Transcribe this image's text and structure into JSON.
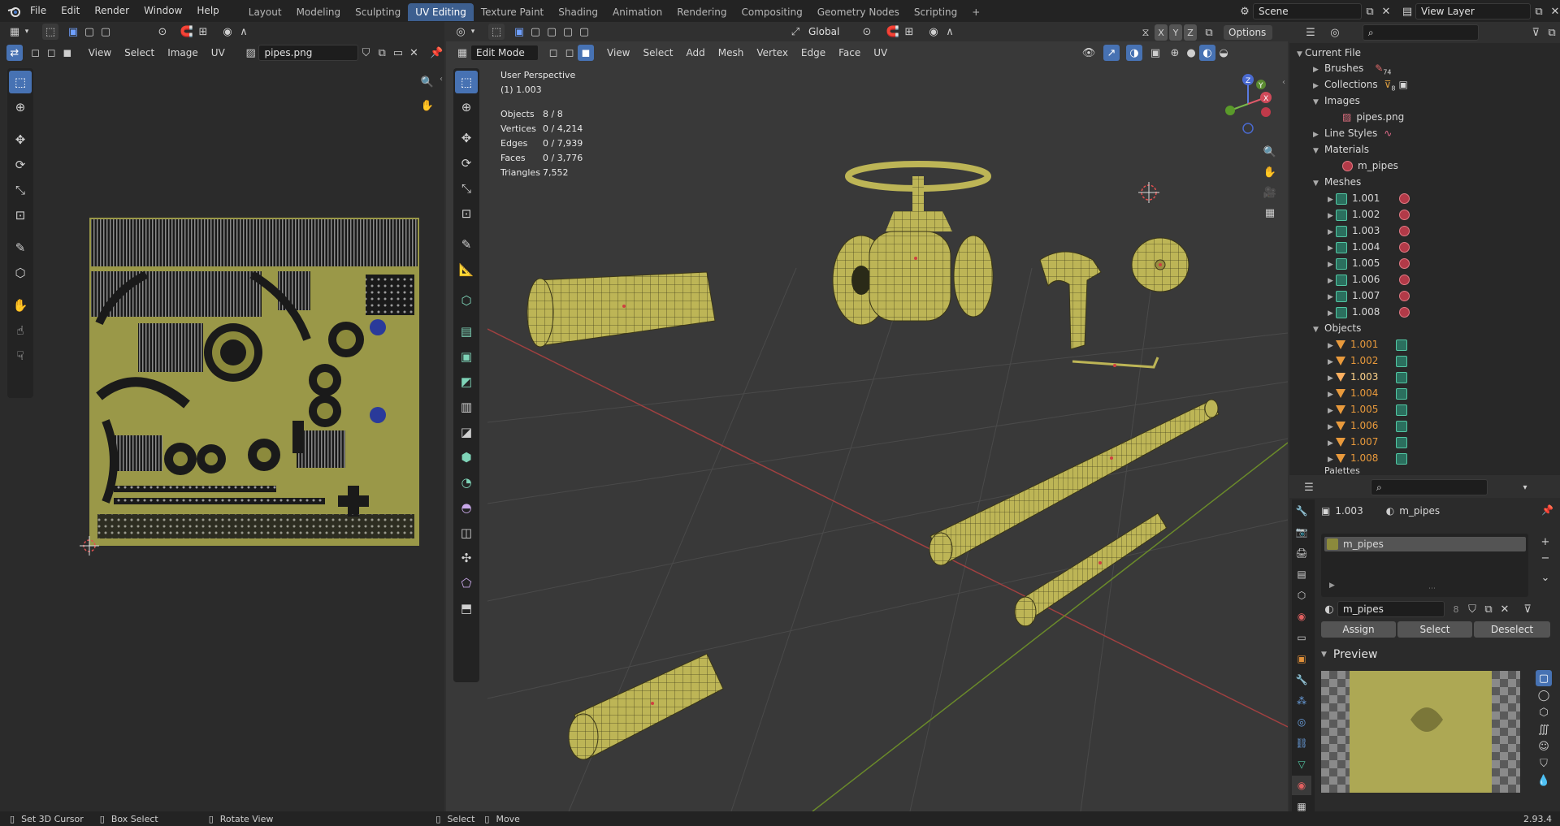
{
  "top_menu": {
    "items": [
      "File",
      "Edit",
      "Render",
      "Window",
      "Help"
    ],
    "workspaces": [
      "Layout",
      "Modeling",
      "Sculpting",
      "UV Editing",
      "Texture Paint",
      "Shading",
      "Animation",
      "Rendering",
      "Compositing",
      "Geometry Nodes",
      "Scripting"
    ],
    "active_workspace": "UV Editing",
    "add_tab": "+",
    "scene": "Scene",
    "view_layer": "View Layer"
  },
  "uv_editor": {
    "menus": [
      "View",
      "Select",
      "Image",
      "UV"
    ],
    "image_name": "pipes.png"
  },
  "viewport": {
    "mode": "Edit Mode",
    "menus": [
      "View",
      "Select",
      "Add",
      "Mesh",
      "Vertex",
      "Edge",
      "Face",
      "UV"
    ],
    "orientation": "Global",
    "options": "Options",
    "axes": [
      "X",
      "Y",
      "Z"
    ],
    "perspective": "User Perspective",
    "active": "(1) 1.003",
    "stats": [
      {
        "label": "Objects",
        "value": "8 / 8"
      },
      {
        "label": "Vertices",
        "value": "0 / 4,214"
      },
      {
        "label": "Edges",
        "value": "0 / 7,939"
      },
      {
        "label": "Faces",
        "value": "0 / 3,776"
      },
      {
        "label": "Triangles",
        "value": "7,552"
      }
    ],
    "gizmo": {
      "x": "X",
      "y": "Y",
      "z": "Z"
    }
  },
  "outliner": {
    "root": "Current File",
    "brushes": "Brushes",
    "brushes_count": "74",
    "collections": "Collections",
    "collections_count": "8",
    "images": "Images",
    "image_item": "pipes.png",
    "line_styles": "Line Styles",
    "materials": "Materials",
    "material_item": "m_pipes",
    "meshes": "Meshes",
    "mesh_items": [
      "1.001",
      "1.002",
      "1.003",
      "1.004",
      "1.005",
      "1.006",
      "1.007",
      "1.008"
    ],
    "objects": "Objects",
    "object_items": [
      "1.001",
      "1.002",
      "1.003",
      "1.004",
      "1.005",
      "1.006",
      "1.007",
      "1.008"
    ],
    "palettes": "Palettes"
  },
  "properties": {
    "object_name": "1.003",
    "material_name": "m_pipes",
    "slot": "m_pipes",
    "material_field": "m_pipes",
    "users": "8",
    "assign": "Assign",
    "select": "Select",
    "deselect": "Deselect",
    "preview_title": "Preview"
  },
  "status_bar": {
    "items": [
      "Set 3D Cursor",
      "Box Select",
      "Rotate View",
      "Select",
      "Move"
    ],
    "version": "2.93.4"
  },
  "colors": {
    "accent": "#4772b3",
    "mesh_yellow": "#c9c15a",
    "object_orange": "#e99a3c"
  }
}
